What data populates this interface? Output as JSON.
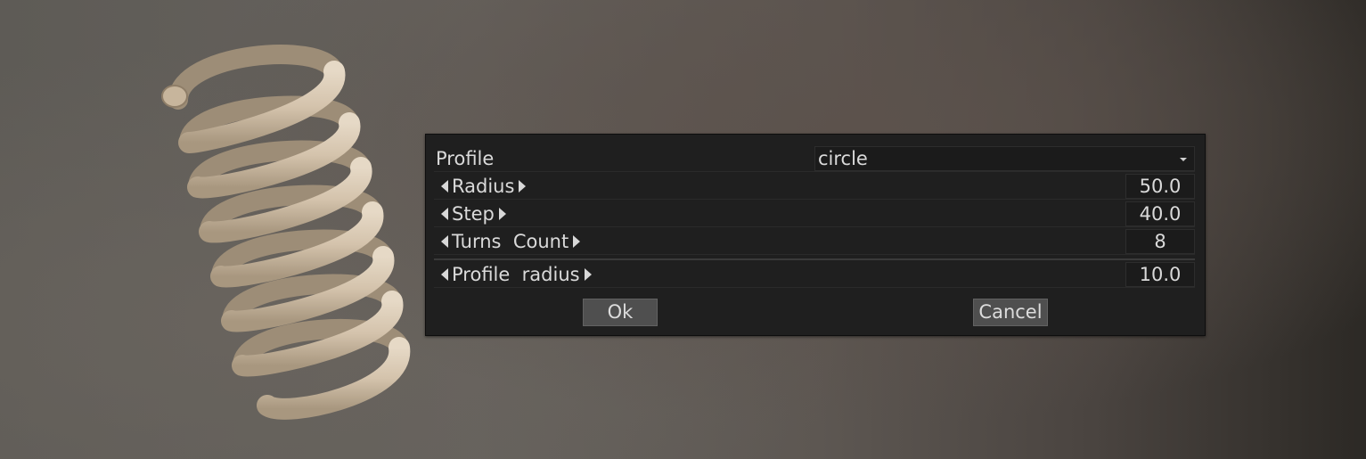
{
  "viewport": {
    "model_color": "#d6c6b0"
  },
  "dialog": {
    "profile": {
      "label": "Profile",
      "value": "circle"
    },
    "fields": [
      {
        "label": "Radius",
        "value": "50.0"
      },
      {
        "label": "Step",
        "value": "40.0"
      },
      {
        "label": "Turns  Count",
        "value": "8"
      },
      {
        "label": "Profile  radius",
        "value": "10.0"
      }
    ],
    "ok_label": "Ok",
    "cancel_label": "Cancel"
  },
  "colors": {
    "dialog_bg": "#1f1f1f",
    "text": "#dadada",
    "button_bg": "#4f4f4f"
  }
}
